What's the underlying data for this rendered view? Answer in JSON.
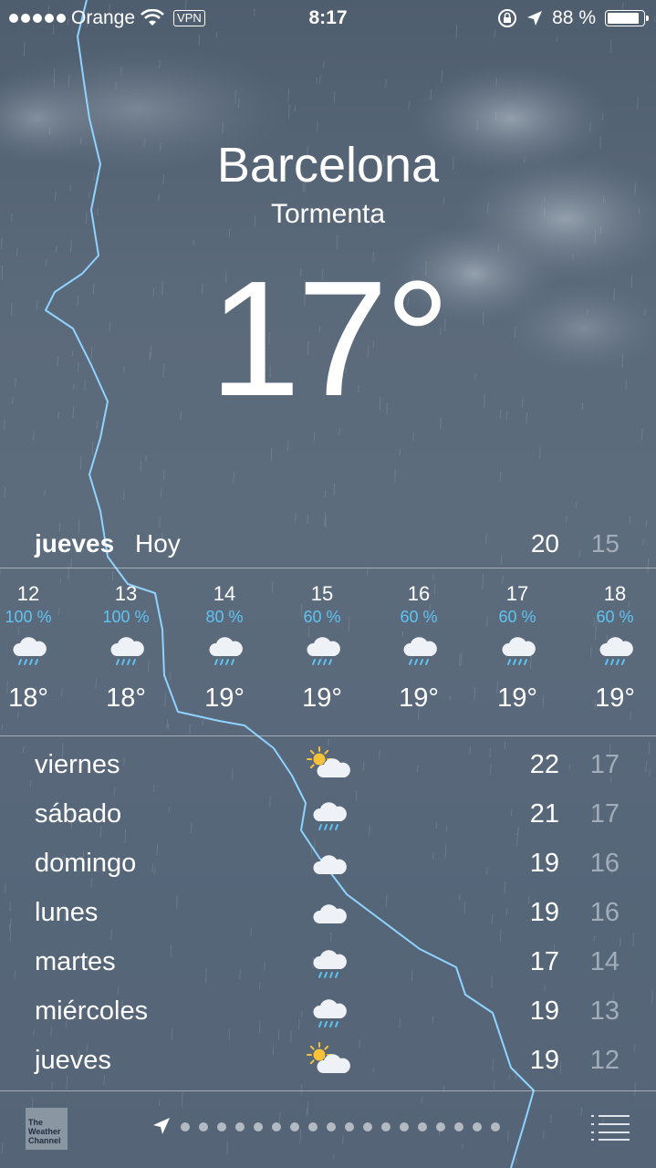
{
  "status_bar": {
    "carrier": "Orange",
    "vpn": "VPN",
    "time": "8:17",
    "battery": "88 %"
  },
  "location": {
    "city": "Barcelona",
    "condition": "Tormenta",
    "temperature": "17°"
  },
  "today": {
    "day": "jueves",
    "label": "Hoy",
    "high": "20",
    "low": "15"
  },
  "hourly": [
    {
      "hour": "12",
      "precip": "100 %",
      "temp": "18°",
      "icon": "rain-cloud-icon"
    },
    {
      "hour": "13",
      "precip": "100 %",
      "temp": "18°",
      "icon": "rain-cloud-icon"
    },
    {
      "hour": "14",
      "precip": "80 %",
      "temp": "19°",
      "icon": "rain-cloud-icon"
    },
    {
      "hour": "15",
      "precip": "60 %",
      "temp": "19°",
      "icon": "rain-cloud-icon"
    },
    {
      "hour": "16",
      "precip": "60 %",
      "temp": "19°",
      "icon": "rain-cloud-icon"
    },
    {
      "hour": "17",
      "precip": "60 %",
      "temp": "19°",
      "icon": "rain-cloud-icon"
    },
    {
      "hour": "18",
      "precip": "60 %",
      "temp": "19°",
      "icon": "rain-cloud-icon"
    }
  ],
  "daily": [
    {
      "day": "viernes",
      "icon": "partly-sunny-icon",
      "high": "22",
      "low": "17"
    },
    {
      "day": "sábado",
      "icon": "rain-cloud-icon",
      "high": "21",
      "low": "17"
    },
    {
      "day": "domingo",
      "icon": "cloud-icon",
      "high": "19",
      "low": "16"
    },
    {
      "day": "lunes",
      "icon": "cloud-icon",
      "high": "19",
      "low": "16"
    },
    {
      "day": "martes",
      "icon": "rain-cloud-icon",
      "high": "17",
      "low": "14"
    },
    {
      "day": "miércoles",
      "icon": "rain-cloud-icon",
      "high": "19",
      "low": "13"
    },
    {
      "day": "jueves",
      "icon": "partly-sunny-icon",
      "high": "19",
      "low": "12"
    }
  ],
  "footer": {
    "logo_text": "The Weather Channel",
    "page_count": 18
  },
  "colors": {
    "precip_blue": "#5fc3f2",
    "low_temp_gray": "#a3adb9",
    "lightning": "#8fd3ff"
  }
}
